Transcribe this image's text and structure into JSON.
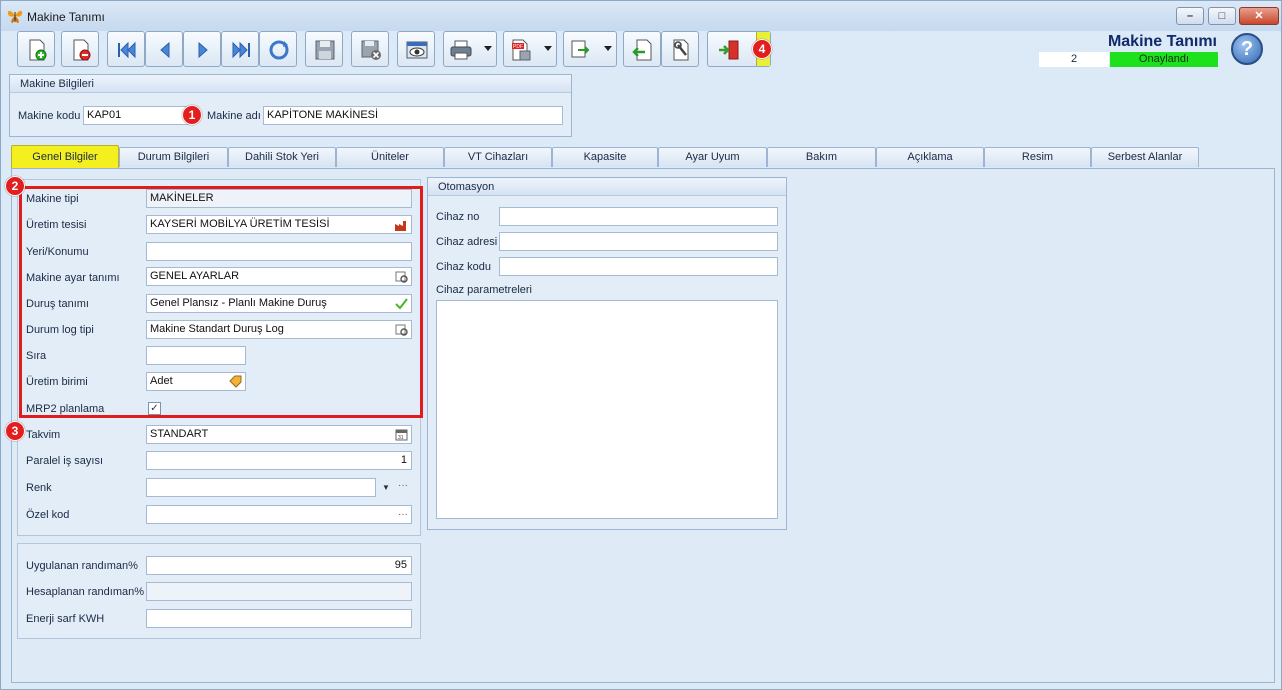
{
  "window": {
    "title": "Makine Tanımı"
  },
  "header": {
    "title": "Makine Tanımı",
    "record_number": "2",
    "status": "Onaylandı"
  },
  "help": {
    "label": "?"
  },
  "badges": {
    "b1": "1",
    "b2": "2",
    "b3": "3",
    "b4": "4"
  },
  "machine_info": {
    "title": "Makine Bilgileri",
    "code_label": "Makine kodu",
    "code_value": "KAP01",
    "name_label": "Makine adı",
    "name_value": "KAPİTONE MAKİNESİ"
  },
  "tabs": [
    "Genel Bilgiler",
    "Durum Bilgileri",
    "Dahili Stok Yeri",
    "Üniteler",
    "VT Cihazları",
    "Kapasite",
    "Ayar Uyum",
    "Bakım",
    "Açıklama",
    "Resim",
    "Serbest Alanlar"
  ],
  "general": {
    "machine_type_label": "Makine tipi",
    "machine_type_value": "MAKİNELER",
    "facility_label": "Üretim tesisi",
    "facility_value": "KAYSERİ MOBİLYA ÜRETİM TESİSİ",
    "location_label": "Yeri/Konumu",
    "location_value": "",
    "setup_label": "Makine ayar tanımı",
    "setup_value": "GENEL AYARLAR",
    "stop_label": "Duruş tanımı",
    "stop_value": "Genel Plansız - Planlı Makine Duruş",
    "log_label": "Durum log tipi",
    "log_value": "Makine Standart Duruş Log",
    "order_label": "Sıra",
    "order_value": "",
    "unit_label": "Üretim birimi",
    "unit_value": "Adet",
    "mrp_label": "MRP2 planlama",
    "mrp_checked": true,
    "calendar_label": "Takvim",
    "calendar_value": "STANDART",
    "parallel_label": "Paralel iş sayısı",
    "parallel_value": "1",
    "color_label": "Renk",
    "color_value": "",
    "special_label": "Özel kod",
    "special_value": ""
  },
  "efficiency": {
    "applied_label": "Uygulanan randıman%",
    "applied_value": "95",
    "calculated_label": "Hesaplanan randıman%",
    "calculated_value": "",
    "energy_label": "Enerji sarf KWH",
    "energy_value": ""
  },
  "automation": {
    "title": "Otomasyon",
    "device_no_label": "Cihaz no",
    "device_no_value": "",
    "device_addr_label": "Cihaz adresi",
    "device_addr_value": "",
    "device_code_label": "Cihaz kodu",
    "device_code_value": "",
    "device_params_label": "Cihaz parametreleri"
  },
  "icons": {
    "app": "butterfly-icon",
    "new": "new-record-icon",
    "delete": "delete-record-icon",
    "first": "first-record-icon",
    "prev": "prev-record-icon",
    "next": "next-record-icon",
    "last": "last-record-icon",
    "refresh": "refresh-icon",
    "save": "save-icon",
    "cancel": "cancel-save-icon",
    "preview": "preview-icon",
    "print": "print-icon",
    "pdf": "pdf-export-icon",
    "export": "export-icon",
    "import": "import-icon",
    "tools": "tools-icon",
    "exit": "exit-icon"
  }
}
